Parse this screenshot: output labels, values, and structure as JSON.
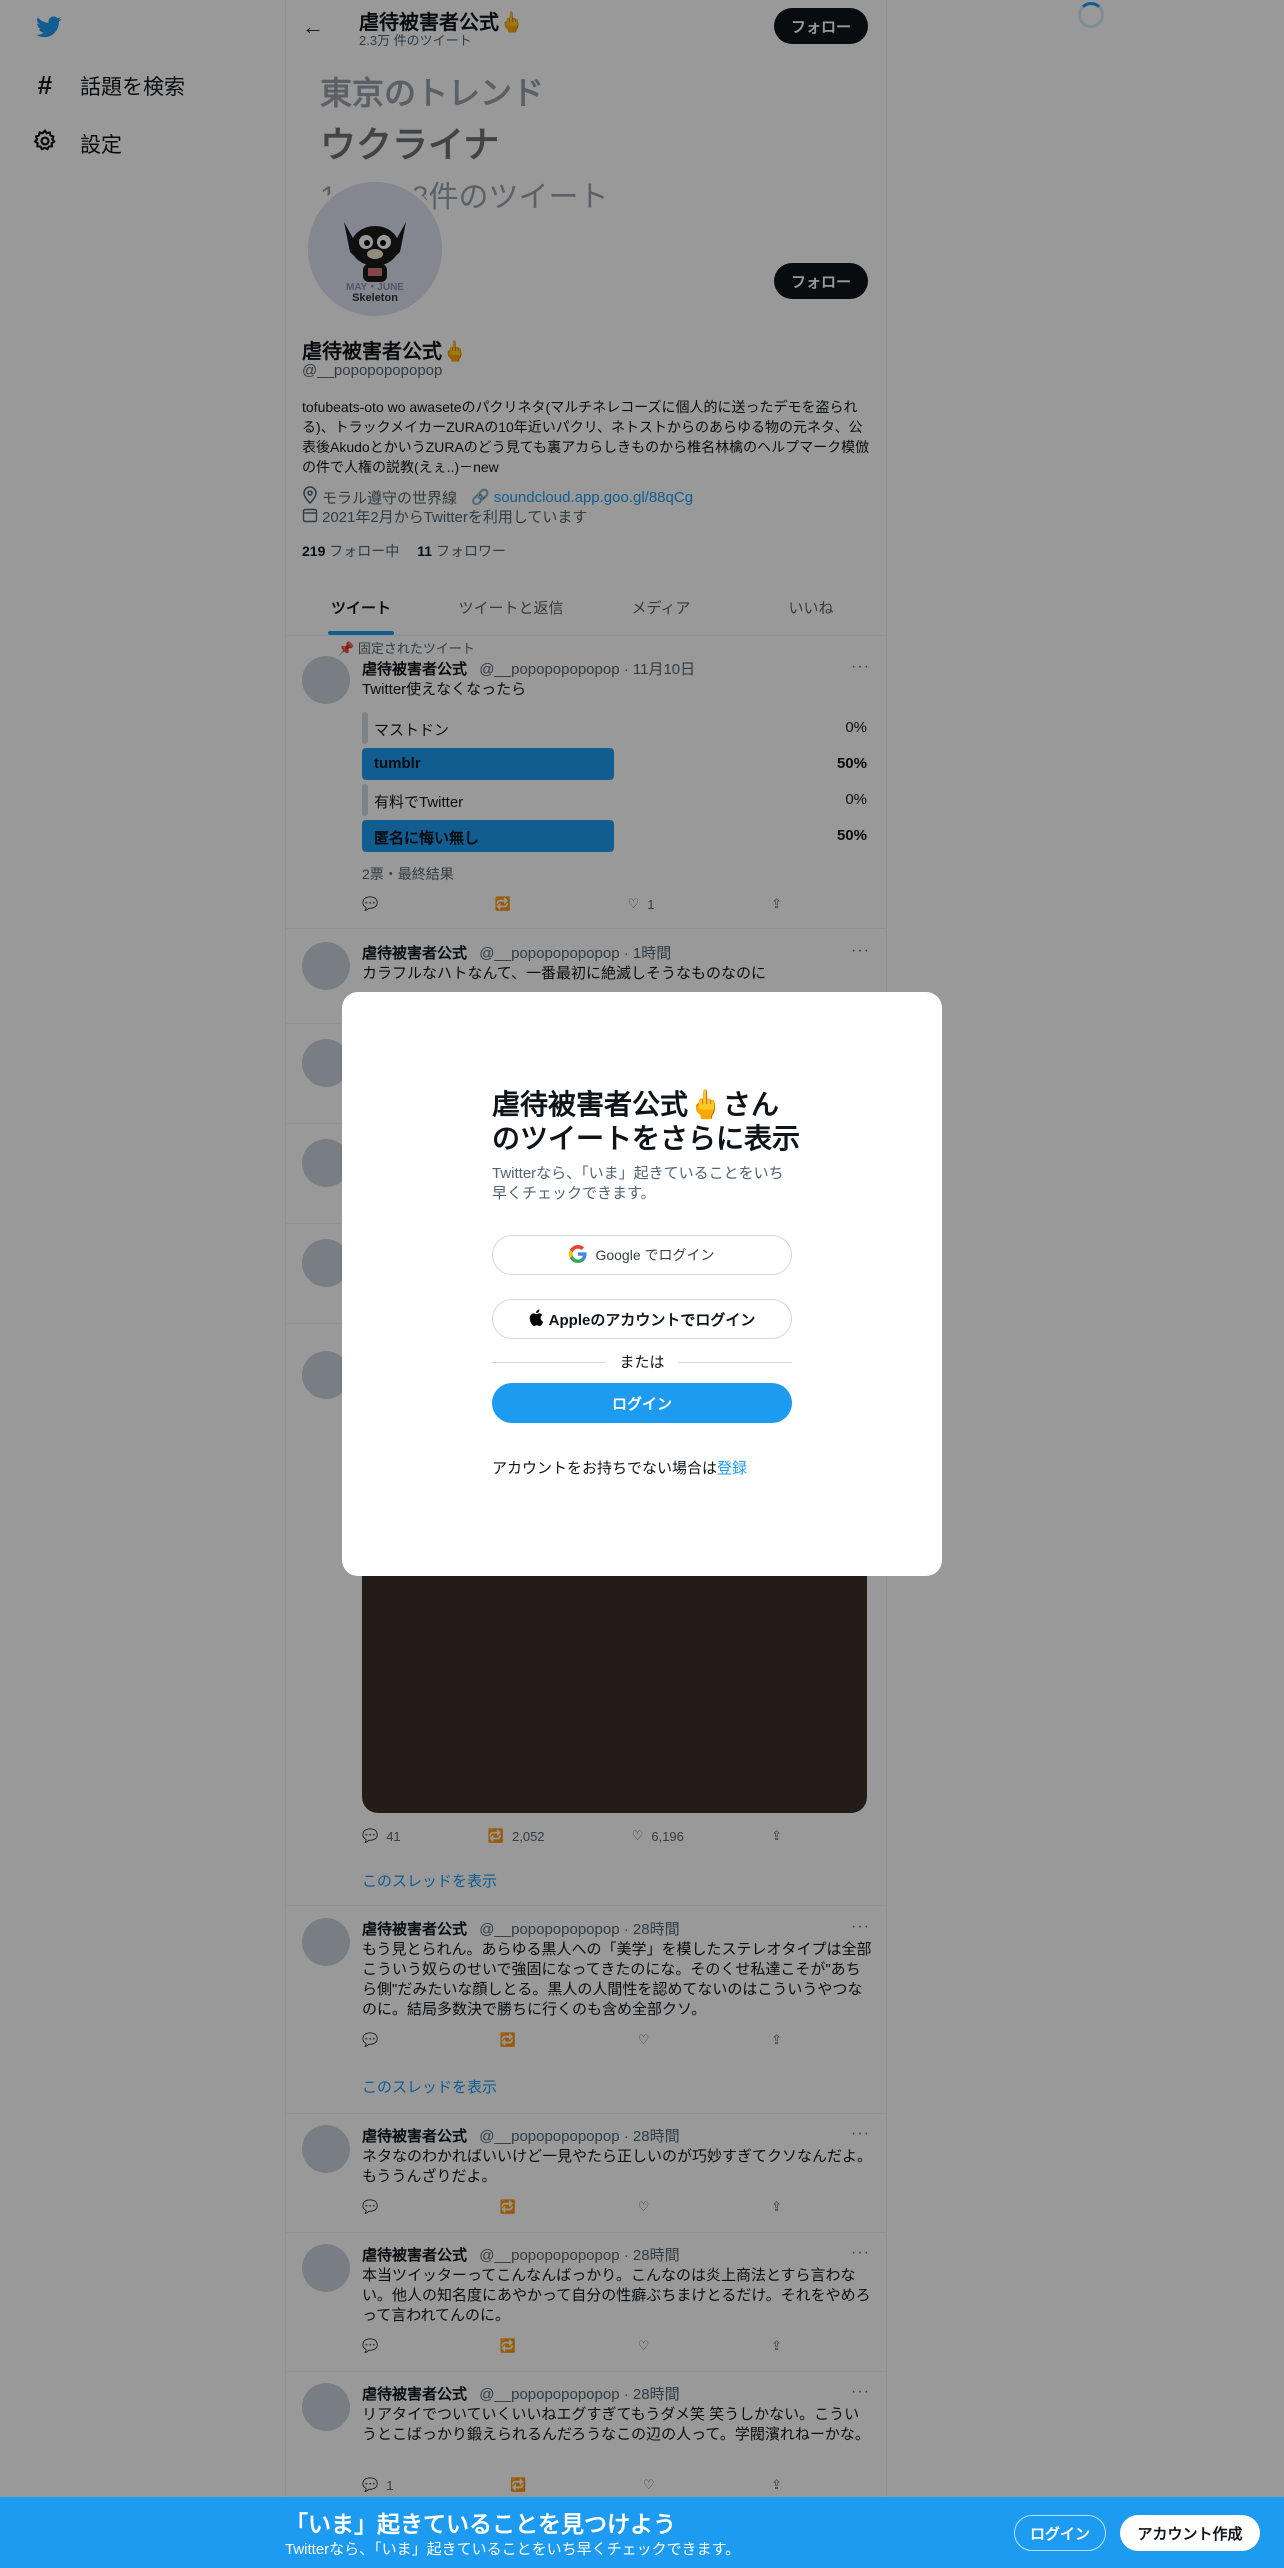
{
  "leftnav": {
    "items": [
      {
        "label": "話題を検索",
        "icon": "hash-icon"
      },
      {
        "label": "設定",
        "icon": "gear-icon"
      }
    ]
  },
  "header": {
    "name": "虐待被害者公式🖕",
    "tweet_count": "2.3万 件のツイート",
    "follow_label": "フォロー"
  },
  "trend_banner": {
    "title": "東京のトレンド",
    "topic": "ウクライナ",
    "count": "130,928件のツイート"
  },
  "profile": {
    "avatar_text1": "MAY・JUNE",
    "avatar_text2": "Skeleton",
    "follow_label": "フォロー",
    "name": "虐待被害者公式🖕",
    "handle": "@__popopopopopop",
    "bio": "tofubeats-oto wo awaseteのパクリネタ(マルチネレコーズに個人的に送ったデモを盗られる)、トラックメイカーZURAの10年近いパクリ、ネトストからのあらゆる物の元ネタ、公表後AkudoとかいうZURAのどう見ても裏アカらしきものから椎名林檎のヘルプマーク模倣の件で人権の説教(えぇ..)－new",
    "location": "モラル遵守の世界線",
    "url": "soundcloud.app.goo.gl/88qCg",
    "joined": "2021年2月からTwitterを利用しています",
    "following_count": "219",
    "following_label": "フォロー中",
    "followers_count": "11",
    "followers_label": "フォロワー"
  },
  "tabs": [
    "ツイート",
    "ツイートと返信",
    "メディア",
    "いいね"
  ],
  "pinned": {
    "label": "固定されたツイート",
    "name": "虐待被害者公式",
    "meta": "@__popopopopopop · 11月10日",
    "text": "Twitter使えなくなったら",
    "poll": [
      {
        "label": "マストドン",
        "pct": "0%",
        "fraction": 0.0,
        "winner": false
      },
      {
        "label": "tumblr",
        "pct": "50%",
        "fraction": 0.5,
        "winner": true
      },
      {
        "label": "有料でTwitter",
        "pct": "0%",
        "fraction": 0.0,
        "winner": false
      },
      {
        "label": "匿名に悔い無し",
        "pct": "50%",
        "fraction": 0.5,
        "winner": true
      }
    ],
    "poll_result": "2票・最終結果",
    "likes": "1"
  },
  "tweet2": {
    "name": "虐待被害者公式",
    "meta": "@__popopopopopop · 1時間",
    "text": "カラフルなハトなんて、一番最初に絶滅しそうなものなのに"
  },
  "media_tweet": {
    "replies": "41",
    "retweets": "2,052",
    "likes": "6,196",
    "thread_link": "このスレッドを表示"
  },
  "tweet3": {
    "name": "虐待被害者公式",
    "meta": "@__popopopopopop · 28時間",
    "text": "もう見とられん。あらゆる黒人への「美学」を模したステレオタイプは全部こういう奴らのせいで強固になってきたのにな。そのくせ私達こそが\"あちら側\"だみたいな顔しとる。黒人の人間性を認めてないのはこういうやつなのに。結局多数決で勝ちに行くのも含め全部クソ。",
    "thread_link": "このスレッドを表示"
  },
  "tweet4": {
    "name": "虐待被害者公式",
    "meta": "@__popopopopopop · 28時間",
    "text": "ネタなのわかればいいけど一見やたら正しいのが巧妙すぎてクソなんだよ。もううんざりだよ。"
  },
  "tweet5": {
    "name": "虐待被害者公式",
    "meta": "@__popopopopopop · 28時間",
    "text": "本当ツイッターってこんなんばっかり。こんなのは炎上商法とすら言わない。他人の知名度にあやかって自分の性癖ぶちまけとるだけ。それをやめろって言われてんのに。"
  },
  "tweet6": {
    "name": "虐待被害者公式",
    "meta": "@__popopopopopop · 28時間",
    "text": "リアタイでついていくいいねエグすぎてもうダメ笑 笑うしかない。こういうとこばっかり鍛えられるんだろうなこの辺の人って。学閥濱れねーかな。",
    "replies": "1"
  },
  "modal": {
    "title": "虐待被害者公式🖕さんのツイートをさらに表示",
    "subtitle": "Twitterなら、「いま」起きていることをいち早くチェックできます。",
    "google_label": "Google でログイン",
    "apple_label": "Appleのアカウントでログイン",
    "or_label": "または",
    "login_label": "ログイン",
    "no_account_text": "アカウントをお持ちでない場合は",
    "signup_link": "登録"
  },
  "bottombar": {
    "title": "「いま」起きていることを見つけよう",
    "subtitle": "Twitterなら、「いま」起きていることをいち早くチェックできます。",
    "login_label": "ログイン",
    "signup_label": "アカウント作成"
  },
  "colors": {
    "brand": "#1d9bf0",
    "poll_winner": "#1d9bf0",
    "poll_loser": "#cfd9de",
    "overlay": "rgba(0,0,0,0.4)"
  }
}
